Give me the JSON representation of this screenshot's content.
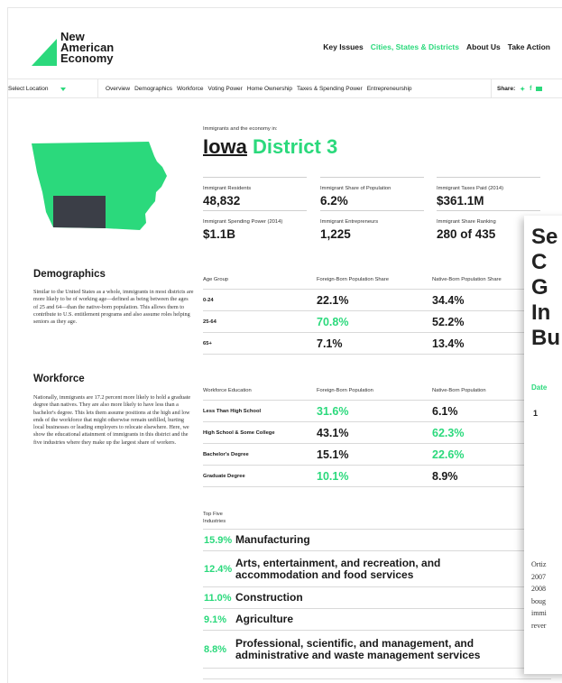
{
  "brand": {
    "line1": "New",
    "line2": "American",
    "line3": "Economy",
    "accent": "#2bd97c"
  },
  "topnav": [
    "Key Issues",
    "Cities, States & Districts",
    "About Us",
    "Take Action"
  ],
  "subnav": {
    "select_label": "Select Location",
    "links": [
      "Overview",
      "Demographics",
      "Workforce",
      "Voting Power",
      "Home Ownership",
      "Taxes & Spending Power",
      "Entrepreneurship"
    ],
    "share_label": "Share:"
  },
  "header": {
    "kicker": "Immigrants and the economy in:",
    "state": "Iowa",
    "district": "District 3"
  },
  "stats": [
    {
      "label": "Immigrant Residents",
      "value": "48,832"
    },
    {
      "label": "Immigrant Share of Population",
      "value": "6.2%"
    },
    {
      "label": "Immigrant Taxes Paid (2014)",
      "value": "$361.1M"
    },
    {
      "label": "Immigrant Spending Power (2014)",
      "value": "$1.1B"
    },
    {
      "label": "Immigrant Entrepreneurs",
      "value": "1,225"
    },
    {
      "label": "Immigrant Share Ranking",
      "value": "280 of 435"
    }
  ],
  "demographics": {
    "heading": "Demographics",
    "text": "Similar to the United States as a whole, immigrants in most districts are more likely to be of working age—defined as being between the ages of 25 and 64—than the native-born population. This allows them to contribute to U.S. entitlement programs and also assume roles helping seniors as they age.",
    "columns": [
      "Age Group",
      "Foreign-Born Population Share",
      "Native-Born Population Share"
    ],
    "rows": [
      {
        "group": "0-24",
        "foreign": "22.1%",
        "native": "34.4%"
      },
      {
        "group": "25-64",
        "foreign": "70.8%",
        "native": "52.2%"
      },
      {
        "group": "65+",
        "foreign": "7.1%",
        "native": "13.4%"
      }
    ]
  },
  "workforce": {
    "heading": "Workforce",
    "text": "Nationally, immigrants are 17.2 percent more likely to hold a graduate degree than natives. They are also more likely to have less than a bachelor's degree. This lets them assume positions at the high and low ends of the workforce that might otherwise remain unfilled, hurting local businesses or leading employers to relocate elsewhere. Here, we show the educational attainment of immigrants in this district and the five industries where they make up the largest share of workers.",
    "columns": [
      "Workforce Education",
      "Foreign-Born Population",
      "Native-Born Population"
    ],
    "rows": [
      {
        "level": "Less Than High School",
        "foreign": "31.6%",
        "native": "6.1%"
      },
      {
        "level": "High School & Some College",
        "foreign": "43.1%",
        "native": "62.3%"
      },
      {
        "level": "Bachelor's Degree",
        "foreign": "15.1%",
        "native": "22.6%"
      },
      {
        "level": "Graduate Degree",
        "foreign": "10.1%",
        "native": "8.9%"
      }
    ]
  },
  "industries": {
    "heading_line1": "Top Five",
    "heading_line2": "Industries",
    "items": [
      {
        "pct": "15.9%",
        "name": "Manufacturing"
      },
      {
        "pct": "12.4%",
        "name": "Arts, entertainment, and recreation, and accommodation and food services"
      },
      {
        "pct": "11.0%",
        "name": "Construction"
      },
      {
        "pct": "9.1%",
        "name": "Agriculture"
      },
      {
        "pct": "8.8%",
        "name": "Professional, scientific, and management, and administrative and waste management services"
      }
    ]
  },
  "overlay": {
    "title_lines": [
      "Se",
      "C",
      "G",
      "In",
      "Bu"
    ],
    "date_label": "Date",
    "number": "1",
    "text_lines": [
      "Ortiz",
      "2007",
      "2008",
      "boug",
      "immi",
      "rever"
    ]
  }
}
